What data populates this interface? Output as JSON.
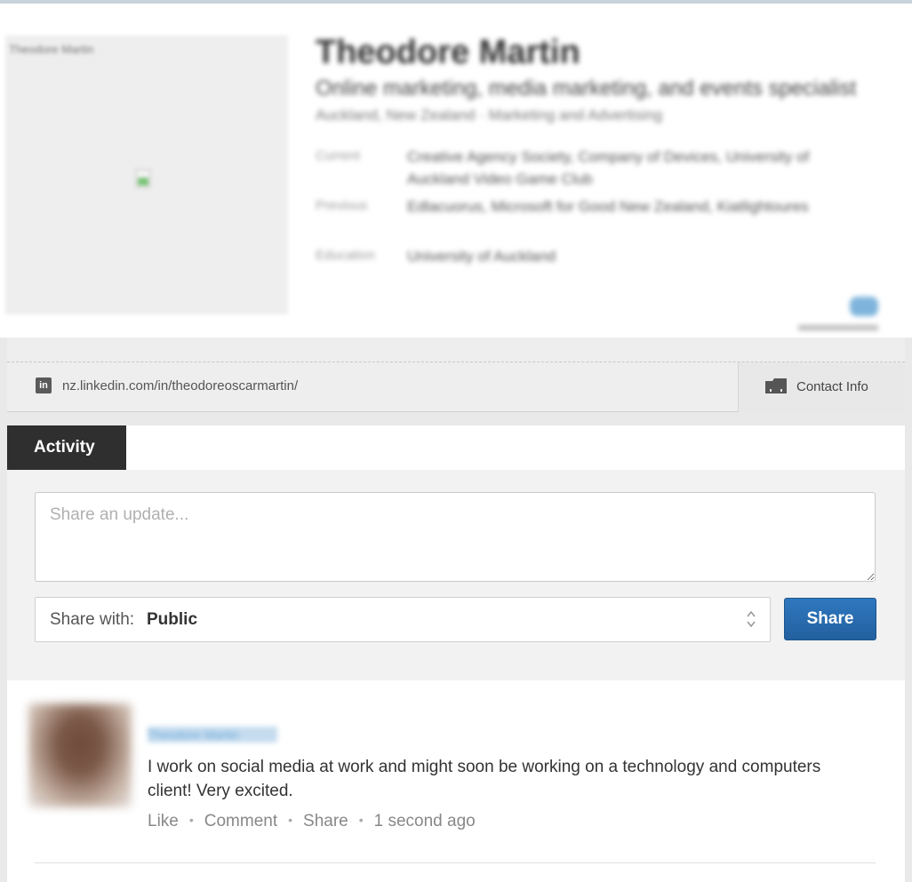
{
  "profile": {
    "photo_label": "Theodore Martin",
    "name": "Theodore Martin",
    "headline": "Online marketing, media marketing, and events specialist",
    "location": "Auckland, New Zealand  ·  Marketing and Advertising",
    "info": [
      {
        "label": "Current",
        "value": "Creative Agency Society, Company of Devices, University of Auckland Video Game Club"
      },
      {
        "label": "Previous",
        "value": "Edlacuorus, Microsoft for Good New Zealand, Kiatlightoures"
      },
      {
        "label": "Education",
        "value": "University of Auckland"
      }
    ]
  },
  "url_bar": {
    "linkedin_icon_text": "in",
    "public_url": "nz.linkedin.com/in/theodoreoscarmartin/",
    "contact_info_label": "Contact Info"
  },
  "activity": {
    "tab_label": "Activity",
    "update_placeholder": "Share an update...",
    "share_with_label": "Share with:",
    "share_with_value": "Public",
    "share_button": "Share"
  },
  "post": {
    "author": "Theodore Martin",
    "text": "I work on social media at work and might soon be working on a technology and computers client! Very excited.",
    "actions": {
      "like": "Like",
      "comment": "Comment",
      "share": "Share",
      "timestamp": "1 second ago"
    }
  }
}
